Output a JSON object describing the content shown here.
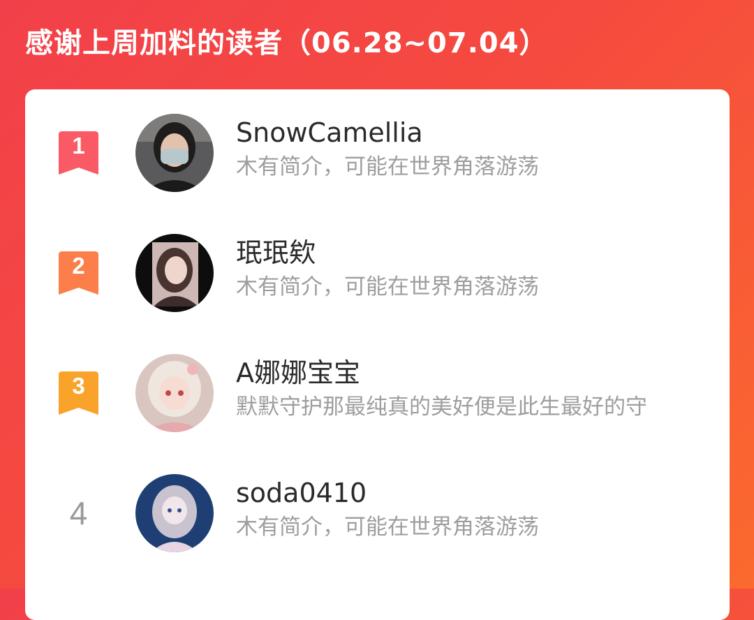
{
  "header": {
    "title": "感谢上周加料的读者（06.28~07.04）"
  },
  "colors": {
    "background_start": "#f2404a",
    "background_end": "#fb6a2e",
    "rank_1": "#f95a65",
    "rank_2": "#fb7e4b",
    "rank_3": "#f9a32a",
    "rank_plain": "#9a9a9a"
  },
  "readers": [
    {
      "rank": "1",
      "name": "SnowCamellia",
      "bio": "木有简介，可能在世界角落游荡"
    },
    {
      "rank": "2",
      "name": "珉珉欸",
      "bio": "木有简介，可能在世界角落游荡"
    },
    {
      "rank": "3",
      "name": "A娜娜宝宝",
      "bio": "默默守护那最纯真的美好便是此生最好的守"
    },
    {
      "rank": "4",
      "name": "soda0410",
      "bio": "木有简介，可能在世界角落游荡"
    }
  ]
}
